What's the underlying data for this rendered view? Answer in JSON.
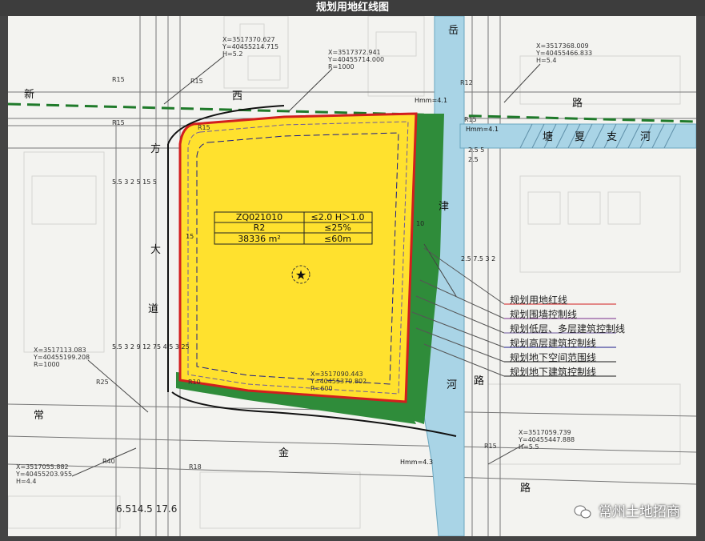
{
  "title": "规划用地红线图",
  "roads": {
    "xin": "新",
    "xi": "西",
    "lu_top": "路",
    "fang": "方",
    "da": "大",
    "dao": "道",
    "chang": "常",
    "jin": "金",
    "lu_bottom": "路",
    "yue": "岳",
    "jin_river": "津",
    "he": "河",
    "lu_right": "路",
    "tang": "塘",
    "xia": "夏",
    "zhi": "支",
    "he_branch": "河"
  },
  "parcel": {
    "code": "ZQ021010",
    "far": "≤2.0 H＞1.0",
    "use": "R2",
    "green": "≤25%",
    "area": "38336 m²",
    "height": "≤60m"
  },
  "coords": {
    "c1": {
      "x": "X=3517370.627",
      "y": "Y=40455214.715",
      "h": "H=5.2"
    },
    "c2": {
      "x": "X=3517372.941",
      "y": "Y=40455714.000",
      "r": "R=1000"
    },
    "c3": {
      "x": "X=3517368.009",
      "y": "Y=40455466.833",
      "h": "H=5.4"
    },
    "c4": {
      "x": "X=3517113.083",
      "y": "Y=40455199.208",
      "r": "R=1000"
    },
    "c5": {
      "x": "X=3517090.443",
      "y": "Y=40455370.802",
      "r": "R=600"
    },
    "c6": {
      "x": "X=3517059.739",
      "y": "Y=40455447.888",
      "h": "H=5.5"
    },
    "c7": {
      "x": "X=3517055.882",
      "y": "Y=40455203.955",
      "h": "H=4.4"
    }
  },
  "radii": {
    "r15a": "R15",
    "r15b": "R15",
    "r15c": "R15",
    "r15d": "R15",
    "r15e": "R15",
    "r12": "R12",
    "r25": "R25",
    "r18": "R18",
    "r40": "R40",
    "r10": "R10",
    "r15f": "R15"
  },
  "elevations": {
    "h1": "Hmm=4.1",
    "h2": "Hmm=4.1",
    "h3": "Hmm=4.3"
  },
  "dims": {
    "left_top": "5.5 3 2 5 15 5",
    "left_bottom": "5.5 3 2 9 12 75 4.5 3 25",
    "right_top": "2.5 5",
    "right_mid": "2.5 7.5 3 2",
    "right_upper": "2.5",
    "bottom": "6.514.5 17.6",
    "dim_15": "15",
    "dim_10": "10"
  },
  "legend": [
    {
      "label": "规划用地红线",
      "color": "#d21e1e"
    },
    {
      "label": "规划围墙控制线",
      "color": "#7a2d8c"
    },
    {
      "label": "规划低层、多层建筑控制线",
      "color": "#6e5a9e"
    },
    {
      "label": "规划高层建筑控制线",
      "color": "#1a1a8a"
    },
    {
      "label": "规划地下空间范围线",
      "color": "#1a1a1a"
    },
    {
      "label": "规划地下建筑控制线",
      "color": "#1a1a1a"
    }
  ],
  "watermark": "常州土地招商",
  "colors": {
    "parcel_fill": "#ffe12e",
    "green_belt": "#2f8c3a",
    "river": "#a9d4e6",
    "red_line": "#d21e1e",
    "dash_green": "#1f7a2a"
  }
}
